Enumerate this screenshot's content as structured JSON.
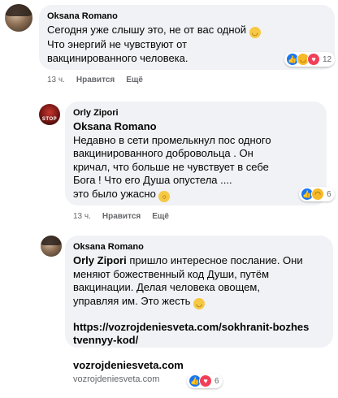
{
  "comment1": {
    "author": "Oksana Romano",
    "text": "Сегодня уже слышу это, не от вас одной",
    "text2": "Что энергий не чувствуют от",
    "text3": "вакцинированного человека.",
    "reaction_count": "12",
    "time": "13 ч.",
    "like": "Нравится",
    "more": "Ещё"
  },
  "comment2": {
    "author": "Orly Zipori",
    "mention": "Oksana Romano",
    "lines": [
      "Недавно в сети промелькнул пос одного",
      "вакцинированного добровольца . Он",
      "кричал, что больше не чувствует в себе",
      "Бога ! Что его Душа опустела ...."
    ],
    "last": "это было ужасно",
    "reaction_count": "6",
    "time": "13 ч.",
    "like": "Нравится",
    "more": "Ещё"
  },
  "comment3": {
    "author": "Oksana Romano",
    "mention": "Orly Zipori",
    "first": " пришло интересное послание. Они",
    "lines": [
      "меняют божественный код Души, путём",
      "вакцинации. Делая человека овощем,",
      "управляя им. Это жесть"
    ],
    "link1": "https://vozrojdeniesveta.com/sokhranit-bozhes",
    "link2": "tvennyy-kod/",
    "preview_title": "vozrojdeniesveta.com",
    "preview_domain": "vozrojdeniesveta.com",
    "reaction_count": "6"
  }
}
